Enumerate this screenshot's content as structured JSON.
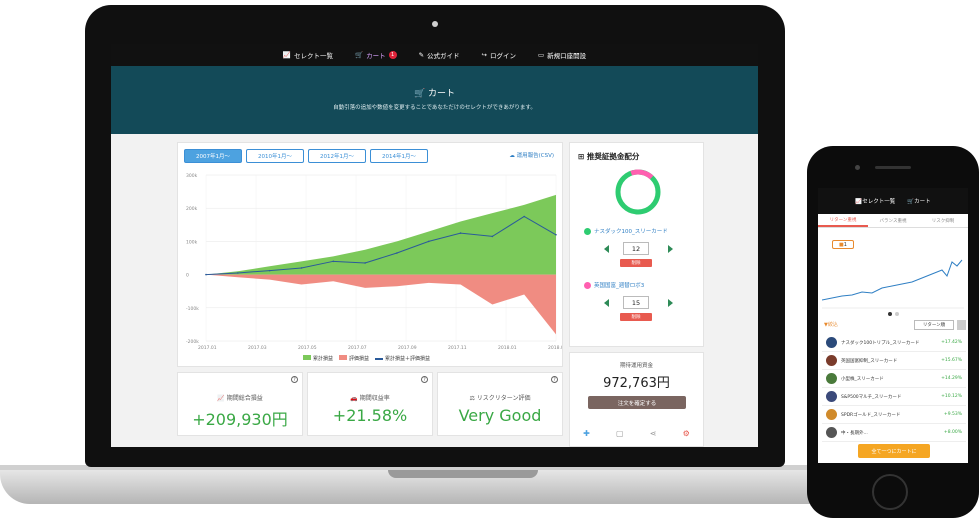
{
  "laptop": {
    "nav": [
      {
        "icon": "chart-icon",
        "label": "セレクト一覧",
        "active": false
      },
      {
        "icon": "cart-icon",
        "label": "カート",
        "active": true,
        "badge": "1"
      },
      {
        "icon": "doc-icon",
        "label": "公式ガイド",
        "active": false
      },
      {
        "icon": "login-icon",
        "label": "ログイン",
        "active": false
      },
      {
        "icon": "monitor-icon",
        "label": "新規口座開設",
        "active": false
      }
    ],
    "banner": {
      "title": "カート",
      "subtitle": "自動引落の追加や数値を変更することであなただけのセレクトができあがります。"
    },
    "periods": [
      "2007年1月〜",
      "2010年1月〜",
      "2012年1月〜",
      "2014年1月〜"
    ],
    "download": "運用報告(CSV)",
    "legend": [
      "累計損益",
      "評価損益",
      "累計損益＋評価損益"
    ],
    "stats": [
      {
        "icon": "chart-icon",
        "label": "期間総合損益",
        "value": "+209,930円"
      },
      {
        "icon": "car-icon",
        "label": "期間収益率",
        "value": "+21.58%"
      },
      {
        "icon": "scale-icon",
        "label": "リスクリターン評価",
        "value": "Very Good"
      }
    ],
    "alloc": {
      "title": "推奨証拠金配分",
      "funds": [
        {
          "name": "ナスダック100_スリーカード",
          "qty": "12",
          "color": "#2ecc71"
        },
        {
          "name": "英国国富_週替ロボ3",
          "qty": "15",
          "color": "#ff5fb0"
        }
      ],
      "delete_label": "削除"
    },
    "summary": {
      "label": "期待運用資金",
      "value": "972,763円",
      "button": "注文を確定する"
    }
  },
  "phone": {
    "nav": [
      "セレクト一覧",
      "カート"
    ],
    "tabs": [
      "リターン重視",
      "バランス重視",
      "リスク抑制"
    ],
    "chip": "1",
    "filter": "▼絞込",
    "sort": "リターン順",
    "rows": [
      {
        "name": "ナスダック100トリプル_スリーカード",
        "value": "+17.42%",
        "color": "#2b4a7a"
      },
      {
        "name": "英国国富抑制_スリーカード",
        "value": "+15.67%",
        "color": "#7a3b2b"
      },
      {
        "name": "小型株_スリーカード",
        "value": "+14.29%",
        "color": "#4a7a3b"
      },
      {
        "name": "S&P500マルチ_スリーカード",
        "value": "+10.12%",
        "color": "#3b4a7a"
      },
      {
        "name": "SPDRゴールド_スリーカード",
        "value": "+9.53%",
        "color": "#d08a2b"
      },
      {
        "name": "中・長期外...",
        "value": "+8.00%",
        "color": "#555"
      }
    ],
    "cta": "全て一つにカートに"
  },
  "chart_data": {
    "type": "area",
    "x_ticks": [
      "2017.01",
      "2017.03",
      "2017.05",
      "2017.07",
      "2017.09",
      "2017.11",
      "2018.01",
      "2018.03"
    ],
    "y_ticks": [
      "300k",
      "200k",
      "100k",
      "0",
      "-100k",
      "-200k"
    ],
    "ylim": [
      -200000,
      300000
    ],
    "series": [
      {
        "name": "累計損益",
        "values": [
          0,
          10000,
          25000,
          40000,
          55000,
          75000,
          100000,
          130000,
          160000,
          185000,
          210000,
          240000
        ],
        "color": "#7cc95a"
      },
      {
        "name": "評価損益",
        "values": [
          0,
          -8000,
          -15000,
          -30000,
          -20000,
          -40000,
          -35000,
          -25000,
          -30000,
          -90000,
          -60000,
          -180000
        ],
        "color": "#f08c82"
      },
      {
        "name": "累計損益＋評価損益",
        "values": [
          0,
          5000,
          12000,
          20000,
          40000,
          35000,
          65000,
          100000,
          125000,
          115000,
          175000,
          120000
        ],
        "color": "#2a5a9a"
      }
    ]
  }
}
